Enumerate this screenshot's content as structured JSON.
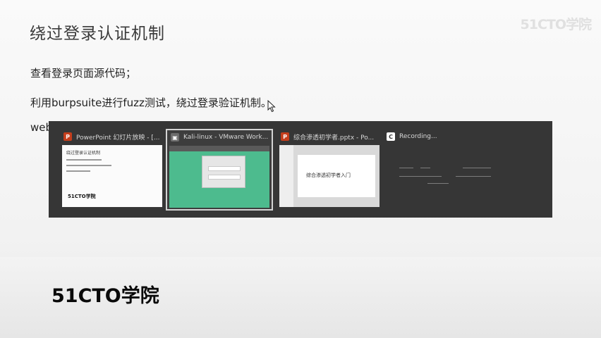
{
  "slide": {
    "title": "绕过登录认证机制",
    "bullets": [
      "查看登录页面源代码；",
      "利用burpsuite进行fuzz测试，绕过登录验证机制。",
      "web"
    ],
    "brand_top": "51CTO学院",
    "brand_bottom": "51CTO学院"
  },
  "task_switcher": {
    "windows": [
      {
        "label": "PowerPoint 幻灯片放映 - [...",
        "icon": "powerpoint-icon",
        "icon_color": "#c43e1c",
        "thumb_title": "绕过登录认证机制",
        "thumb_logo": "51CTO学院"
      },
      {
        "label": "Kali-linux - VMware Work...",
        "icon": "vmware-icon",
        "icon_color": "#6d6d6d",
        "selected": true
      },
      {
        "label": "综合渗透初学者.pptx - Po...",
        "icon": "powerpoint-icon",
        "icon_color": "#c43e1c",
        "thumb_text": "综合渗透初学者入门"
      },
      {
        "label": "Recording...",
        "icon": "recording-icon",
        "icon_color": "#ffffff"
      }
    ]
  },
  "colors": {
    "switcher_bg": "#363636",
    "vm_green": "#4dbb8e"
  }
}
